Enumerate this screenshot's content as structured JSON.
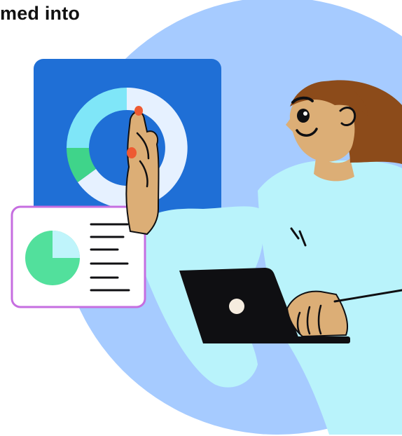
{
  "caption": {
    "text": "med into"
  },
  "icons": [
    "blue-circle-background",
    "donut-chart-card",
    "pie-chart-report-card",
    "woman-with-laptop-figure",
    "laptop-icon"
  ],
  "colors": {
    "circle": "#a6cbff",
    "card_blue": "#1f6fd6",
    "donut_light": "#e6f1ff",
    "donut_cyan": "#7fe6f8",
    "donut_green": "#3fd48a",
    "report_border": "#c66ee0",
    "pie_green": "#52e09c",
    "pie_cyan": "#bff4fb",
    "shirt": "#b9f3fb",
    "skin": "#dcae76",
    "hair": "#8c4b1a",
    "laptop": "#0f0f12",
    "nail": "#ee5a32",
    "ink": "#0f0f12"
  }
}
